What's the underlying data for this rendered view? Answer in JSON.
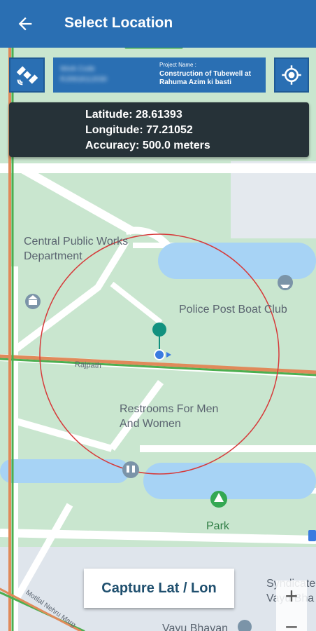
{
  "header": {
    "title": "Select Location"
  },
  "project": {
    "work_code_label": "Work Code",
    "work_code_value": "RJ0918112030",
    "project_name_label": "Project Name :",
    "project_name": "Construction of Tubewell at Rahuma Azim ki basti"
  },
  "location": {
    "latitude_text": "Latitude: 28.61393",
    "longitude_text": "Longitude: 77.21052",
    "accuracy_text": "Accuracy: 500.0 meters"
  },
  "map": {
    "labels": {
      "cpwd": "Central Public Works Department",
      "police": "Police Post Boat Club",
      "rajpath": "Rajpath",
      "restrooms": "Restrooms For Men And Women",
      "park": "Park",
      "syndicate": "Syndicate Vayu Bha",
      "vayu": "Vayu Bhavan",
      "road_sw": "Motilal Nehru Marg"
    },
    "colors": {
      "water": "#a7d3f5",
      "park": "#c9e6cf",
      "road": "#ffffff",
      "accuracy_circle": "#d63a3a",
      "marker": "#12917f"
    }
  },
  "actions": {
    "capture_label": "Capture Lat / Lon",
    "zoom_in": "+",
    "zoom_out": "−"
  }
}
